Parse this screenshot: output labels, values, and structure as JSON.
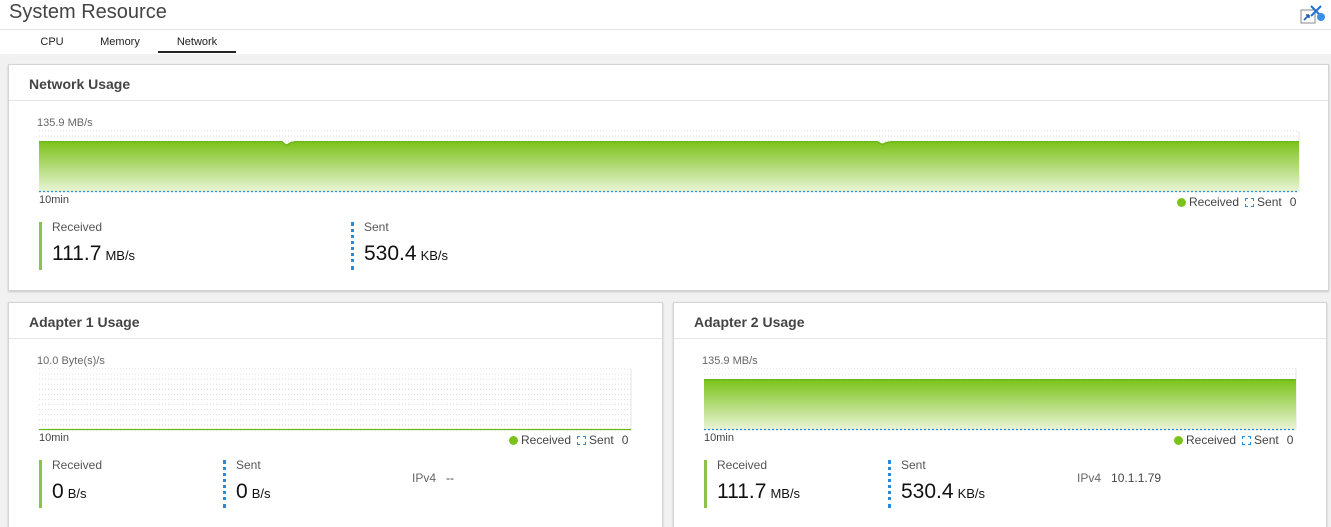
{
  "app": {
    "title": "System Resource",
    "icon": "monitor-app-icon"
  },
  "tabs": [
    {
      "label": "CPU",
      "active": false
    },
    {
      "label": "Memory",
      "active": false
    },
    {
      "label": "Network",
      "active": true
    }
  ],
  "legend": {
    "received": "Received",
    "sent": "Sent",
    "zero": "0"
  },
  "colors": {
    "received": "#8bc34a",
    "sent": "#2a8ad8"
  },
  "network": {
    "title": "Network Usage",
    "chart_data": {
      "type": "area",
      "ymax_label": "135.9 MB/s",
      "xlabel": "10min",
      "ylim": [
        0,
        135.9
      ],
      "series": [
        {
          "name": "Received",
          "values": [
            112,
            112,
            112,
            112,
            112,
            112,
            112,
            112,
            112,
            112,
            112,
            112,
            112,
            112,
            112,
            112,
            112,
            112,
            112,
            112,
            112,
            112,
            112,
            112,
            112,
            112,
            112,
            112,
            112,
            112,
            112,
            112,
            112,
            112,
            112,
            112,
            112,
            112,
            112,
            112,
            112,
            112,
            112,
            112,
            112,
            112,
            112,
            112,
            112,
            112,
            112,
            112,
            112,
            112,
            104,
            110,
            112,
            112,
            112,
            112,
            112,
            112,
            112,
            112,
            112,
            112,
            112,
            112,
            112,
            112,
            112,
            112,
            112,
            112,
            112,
            112,
            112,
            112,
            112,
            112,
            112,
            112,
            112,
            112,
            112,
            112,
            112,
            112,
            112,
            112,
            112,
            112,
            112,
            112,
            112,
            112,
            112,
            112,
            112,
            112,
            112,
            112,
            112,
            112,
            112,
            112,
            112,
            112,
            112,
            112,
            112,
            112,
            112,
            112,
            112,
            112,
            112,
            112,
            112,
            112,
            112,
            112,
            112,
            112,
            112,
            112,
            112,
            112,
            112,
            112,
            112,
            112,
            112,
            112,
            112,
            112,
            112,
            112,
            112,
            112,
            112,
            112,
            112,
            112,
            112,
            112,
            112,
            112,
            112,
            112,
            112,
            112,
            112,
            112,
            112,
            112,
            112,
            112,
            112,
            112,
            112,
            112,
            112,
            112,
            112,
            112,
            112,
            112,
            112,
            112,
            112,
            112,
            112,
            112,
            112,
            112,
            112,
            112,
            112,
            112,
            112,
            112,
            112,
            112,
            106,
            110,
            112,
            112,
            112,
            112,
            112,
            112,
            112,
            112,
            112,
            112,
            112,
            112,
            112,
            112,
            112,
            112,
            112,
            112,
            112,
            112,
            112,
            112,
            112,
            112,
            112,
            112,
            112,
            112,
            112,
            112,
            112,
            112,
            112,
            112,
            112,
            112,
            112,
            112,
            112,
            112,
            112,
            112,
            112,
            112,
            112,
            112,
            112,
            112,
            112,
            112,
            112,
            112,
            112,
            112,
            112,
            112,
            112,
            112,
            112,
            112,
            112,
            112,
            112,
            112,
            112,
            112,
            112,
            112,
            112,
            112,
            112,
            112,
            112,
            112,
            112,
            112,
            112,
            112,
            112,
            112,
            112,
            112,
            112,
            112,
            112,
            112,
            112,
            112,
            112,
            112
          ]
        },
        {
          "name": "Sent",
          "values": [
            0.5
          ]
        }
      ]
    },
    "received": {
      "label": "Received",
      "value": "111.7",
      "unit": "MB/s"
    },
    "sent": {
      "label": "Sent",
      "value": "530.4",
      "unit": "KB/s"
    }
  },
  "adapter1": {
    "title": "Adapter 1 Usage",
    "chart_data": {
      "type": "area",
      "ymax_label": "10.0 Byte(s)/s",
      "xlabel": "10min",
      "ylim": [
        0,
        10
      ],
      "series": [
        {
          "name": "Received",
          "values": [
            0
          ]
        },
        {
          "name": "Sent",
          "values": [
            0
          ]
        }
      ]
    },
    "received": {
      "label": "Received",
      "value": "0",
      "unit": "B/s"
    },
    "sent": {
      "label": "Sent",
      "value": "0",
      "unit": "B/s"
    },
    "ipv4": {
      "label": "IPv4",
      "value": "--"
    }
  },
  "adapter2": {
    "title": "Adapter 2 Usage",
    "chart_data": {
      "type": "area",
      "ymax_label": "135.9 MB/s",
      "xlabel": "10min",
      "ylim": [
        0,
        135.9
      ],
      "series": [
        {
          "name": "Received",
          "values": [
            112,
            112,
            112,
            112,
            112,
            112,
            112,
            112,
            112,
            112,
            112,
            112,
            112,
            112,
            112,
            112,
            112,
            112,
            112,
            112,
            112,
            112,
            112,
            112,
            112,
            112,
            112,
            112,
            112,
            112,
            112,
            112,
            112,
            112,
            112,
            112,
            112,
            112,
            112,
            112,
            112,
            112,
            112,
            112,
            112,
            112,
            112,
            112,
            112,
            112,
            112,
            112,
            112,
            112,
            112,
            112,
            112,
            112,
            112,
            112,
            112,
            112,
            112,
            112,
            112,
            112,
            112,
            112,
            112,
            112,
            112,
            112,
            112,
            112,
            112,
            112,
            112,
            112,
            112,
            112,
            112,
            112,
            112,
            112,
            112,
            112,
            112,
            112,
            112,
            112,
            112,
            112,
            112,
            112,
            112,
            112,
            112,
            112,
            112,
            112,
            112,
            112,
            112,
            112,
            112,
            112,
            112,
            112,
            112,
            112,
            112,
            112,
            112,
            112,
            112,
            112,
            112,
            112,
            112,
            112,
            112,
            112,
            112,
            112,
            112,
            112,
            112,
            112,
            112,
            112,
            112,
            112,
            112,
            112,
            112,
            112,
            112,
            112,
            112,
            112,
            112,
            112,
            112,
            112,
            112,
            112,
            112,
            112,
            112,
            112,
            112,
            112,
            112,
            112,
            112,
            112,
            112,
            112,
            112,
            112,
            112,
            112,
            112,
            112,
            112,
            112,
            112,
            112,
            112,
            112,
            112,
            112,
            112,
            112,
            112,
            112,
            112,
            112,
            112,
            112,
            112,
            112,
            112,
            112,
            112,
            112,
            112,
            112,
            112,
            112,
            112,
            112,
            112,
            112,
            112,
            112,
            112,
            112,
            112,
            112,
            112,
            112,
            112,
            112,
            112,
            112,
            112,
            112,
            112,
            112,
            112,
            112,
            112,
            112,
            112,
            112,
            112,
            112,
            112,
            112,
            112,
            112,
            112,
            112,
            112,
            112,
            112,
            112,
            112,
            112,
            112,
            112,
            112,
            112,
            112,
            112,
            112,
            112,
            112,
            112,
            112,
            112,
            112,
            112,
            112,
            112,
            112,
            112,
            112,
            112,
            112,
            112,
            112,
            112,
            112,
            112,
            112,
            112,
            112,
            112,
            112,
            112,
            112,
            112,
            112,
            112,
            112,
            112,
            112,
            112,
            112,
            112,
            112,
            112,
            112,
            112,
            112,
            112,
            112,
            112,
            112,
            112,
            112,
            112,
            112,
            112,
            112,
            112,
            112,
            112,
            112,
            112
          ]
        },
        {
          "name": "Sent",
          "values": [
            0.5
          ]
        }
      ]
    },
    "received": {
      "label": "Received",
      "value": "111.7",
      "unit": "MB/s"
    },
    "sent": {
      "label": "Sent",
      "value": "530.4",
      "unit": "KB/s"
    },
    "ipv4": {
      "label": "IPv4",
      "value": "10.1.1.79"
    }
  }
}
